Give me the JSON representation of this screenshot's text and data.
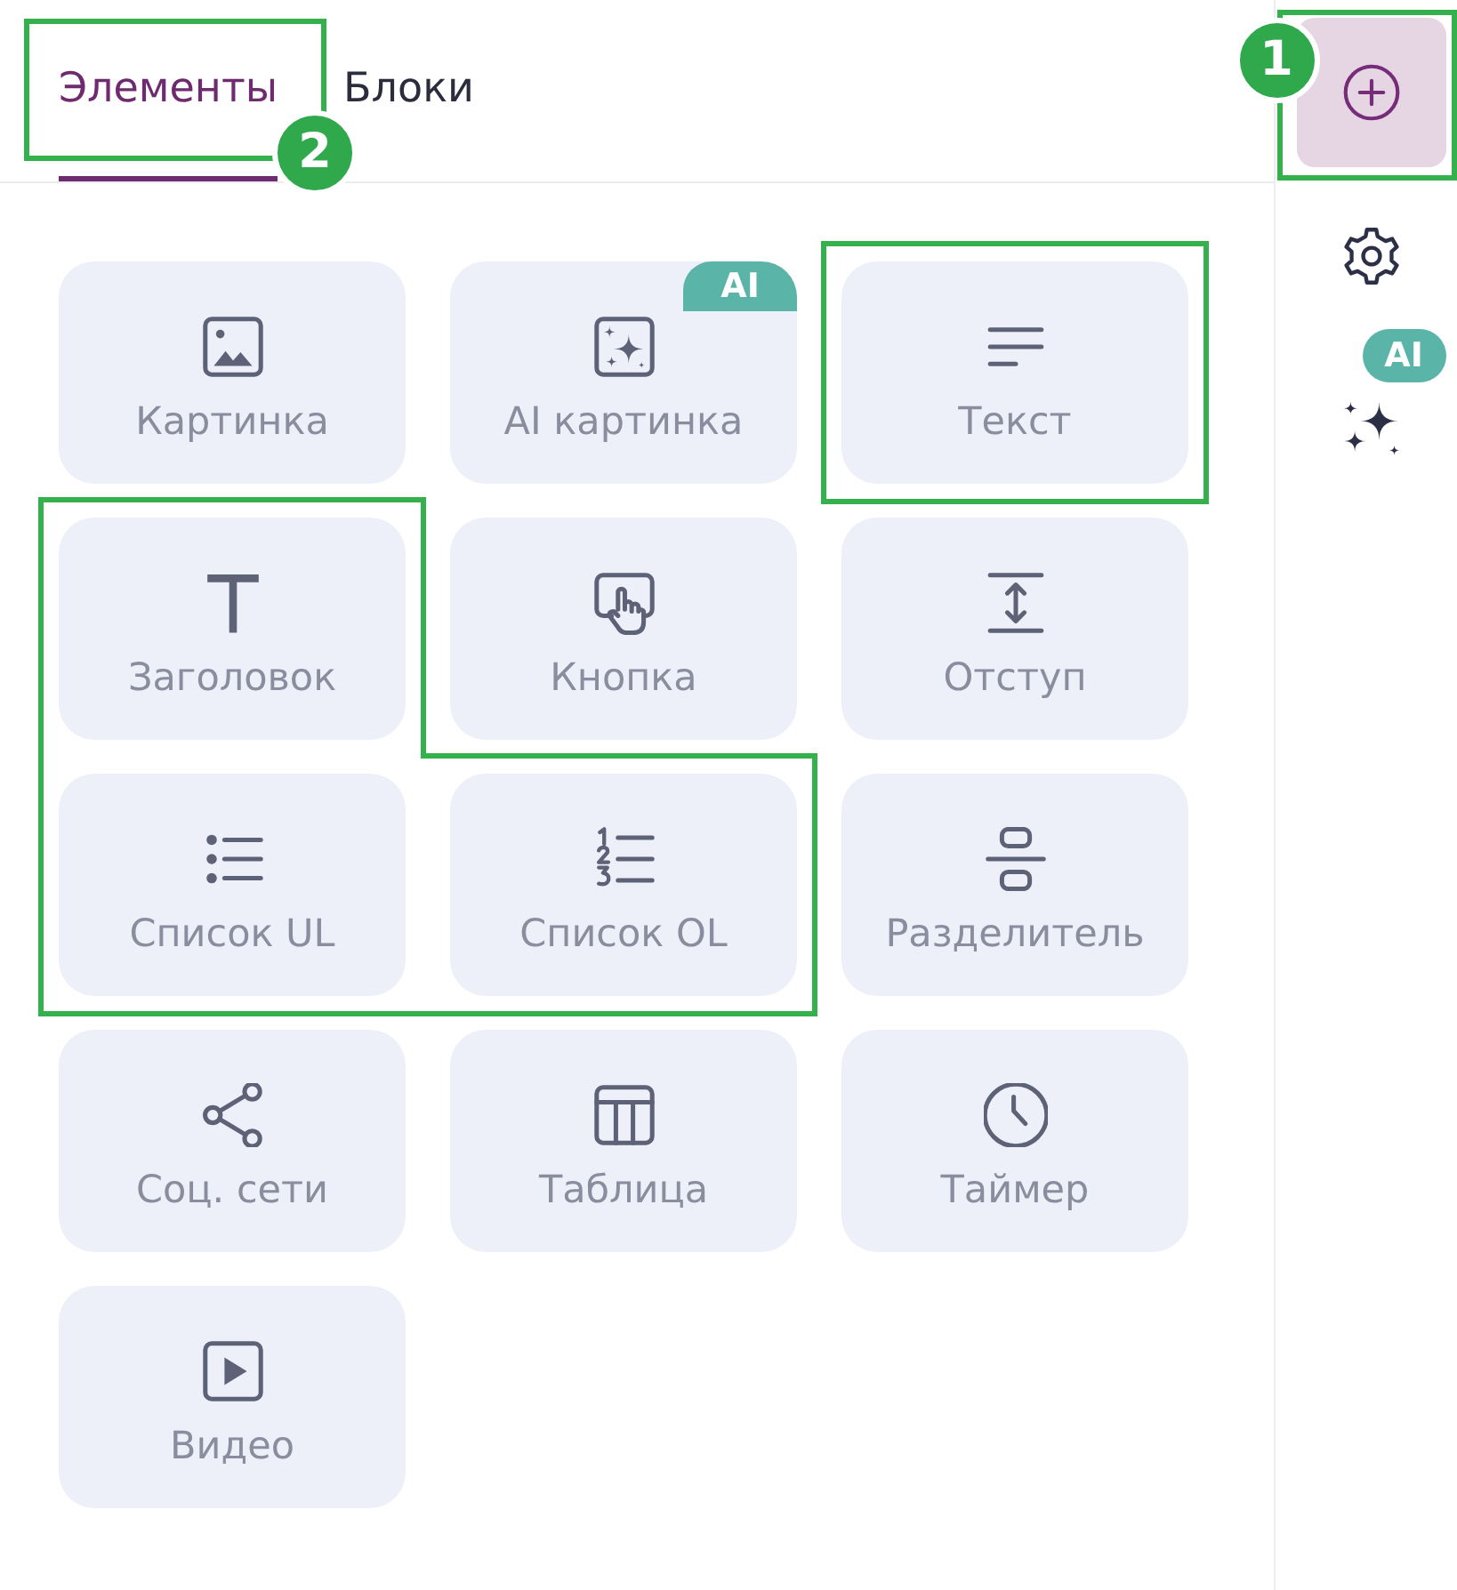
{
  "tabs": [
    {
      "label": "Элементы",
      "selected": true,
      "highlighted": true,
      "callout": "2"
    },
    {
      "label": "Блоки",
      "selected": false,
      "highlighted": false
    }
  ],
  "tile_badge": "AI",
  "elements": [
    {
      "kind": "image",
      "label": "Картинка",
      "badged": false,
      "highlighted": false
    },
    {
      "kind": "ai_image",
      "label": "AI картинка",
      "badged": true,
      "highlighted": false
    },
    {
      "kind": "text",
      "label": "Текст",
      "badged": false,
      "highlighted": true
    },
    {
      "kind": "heading",
      "label": "Заголовок",
      "badged": false,
      "highlighted": true
    },
    {
      "kind": "button",
      "label": "Кнопка",
      "badged": false,
      "highlighted": false
    },
    {
      "kind": "spacer",
      "label": "Отступ",
      "badged": false,
      "highlighted": false
    },
    {
      "kind": "bullet_list",
      "label": "Список UL",
      "badged": false,
      "highlighted": true
    },
    {
      "kind": "numbered_list",
      "label": "Список OL",
      "badged": false,
      "highlighted": true
    },
    {
      "kind": "divider",
      "label": "Разделитель",
      "badged": false,
      "highlighted": false
    },
    {
      "kind": "social",
      "label": "Соц. сети",
      "badged": false,
      "highlighted": false
    },
    {
      "kind": "table",
      "label": "Таблица",
      "badged": false,
      "highlighted": false
    },
    {
      "kind": "timer",
      "label": "Таймер",
      "badged": false,
      "highlighted": false
    },
    {
      "kind": "video",
      "label": "Видео",
      "badged": false,
      "highlighted": false
    }
  ],
  "sidebar": {
    "items": [
      {
        "kind": "add",
        "selected": true,
        "highlighted": true,
        "callout": "1"
      },
      {
        "kind": "settings",
        "selected": false,
        "highlighted": false
      },
      {
        "kind": "ai",
        "selected": false,
        "highlighted": false,
        "badge": "AI"
      }
    ]
  }
}
